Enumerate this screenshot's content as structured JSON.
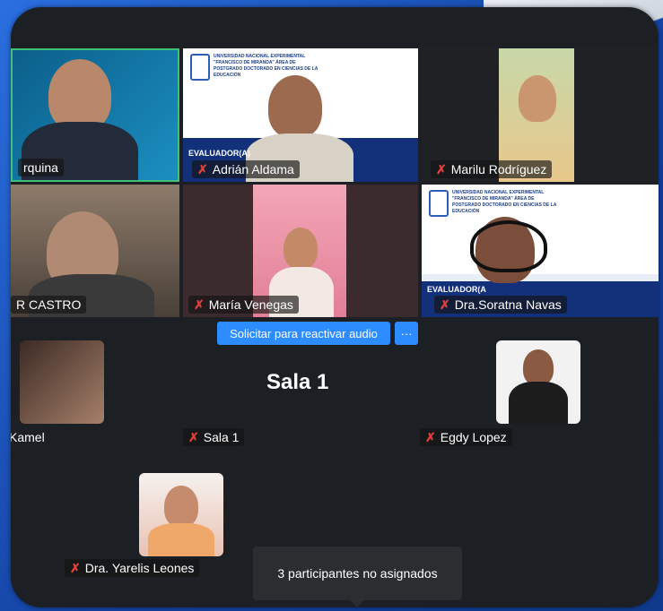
{
  "participants": {
    "p1": {
      "name": "rquina"
    },
    "p2": {
      "name": "Adrián Aldama",
      "role": "EVALUADOR(A)"
    },
    "p3": {
      "name": "Marilu Rodríguez"
    },
    "p4": {
      "name": "R CASTRO"
    },
    "p5": {
      "name": "María Venegas"
    },
    "p6": {
      "name": "Dra.Soratna Navas",
      "role": "EVALUADOR(A"
    }
  },
  "slide_text": "UNIVERSIDAD NACIONAL EXPERIMENTAL \"FRANCISCO DE MIRANDA\" ÁREA DE POSTGRADO DOCTORADO EN CIENCIAS DE LA EDUCACIÓN",
  "audio_button": {
    "label": "Solicitar para reactivar audio",
    "more": "···"
  },
  "room": {
    "title": "Sala 1",
    "members": [
      {
        "name": "Kamel"
      },
      {
        "name": "Sala 1"
      },
      {
        "name": "Egdy Lopez"
      },
      {
        "name": "Dra. Yarelis Leones"
      }
    ]
  },
  "tooltip": "3 participantes no asignados",
  "colors": {
    "accent": "#2d8cff",
    "muted": "#e0403a",
    "speaking_border": "#3ec27a"
  }
}
